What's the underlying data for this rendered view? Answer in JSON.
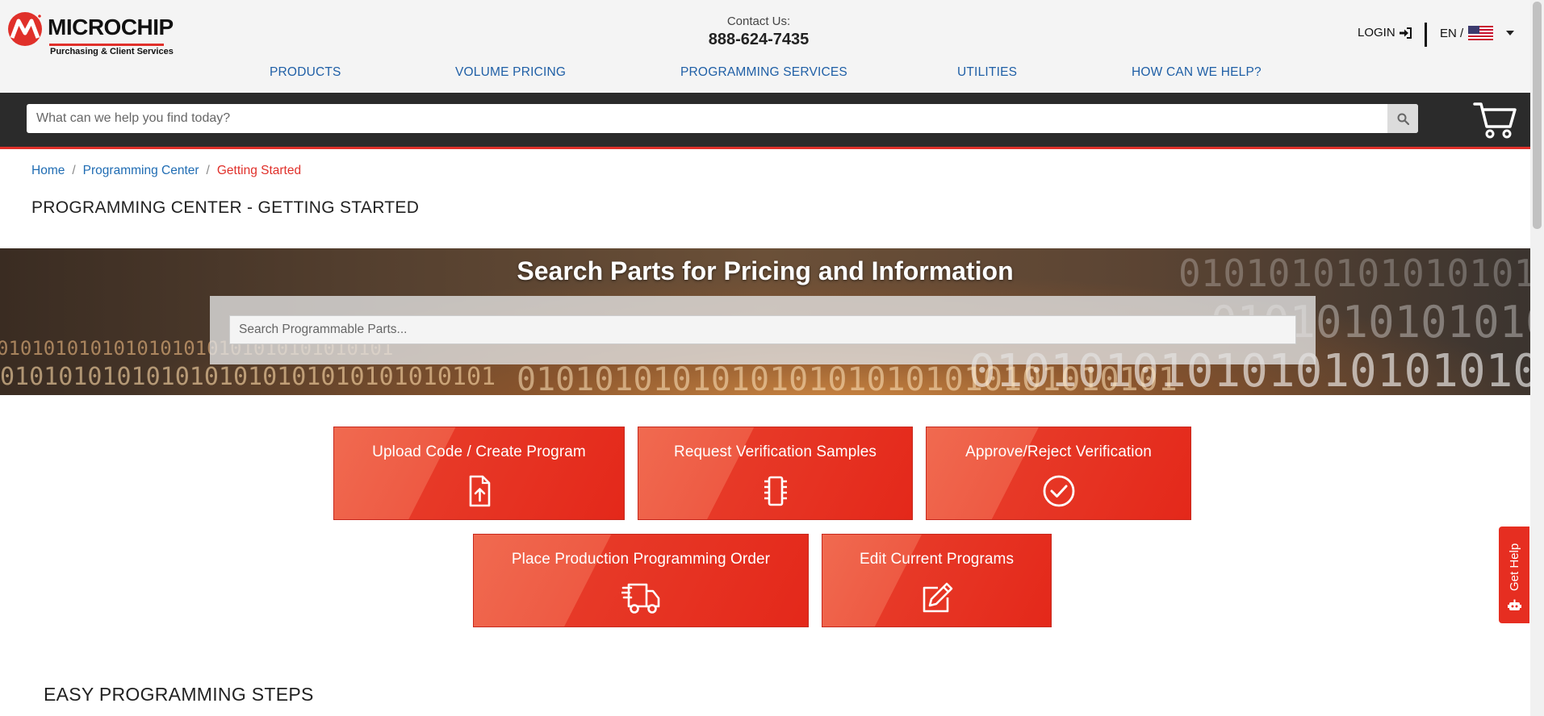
{
  "header": {
    "logo_word": "MICROCHIP",
    "logo_sub": "Purchasing & Client Services",
    "contact_label": "Contact Us:",
    "contact_phone": "888-624-7435",
    "login_label": "LOGIN",
    "lang_label": "EN /",
    "brand_color": "#e0302a"
  },
  "nav": {
    "items": [
      "PRODUCTS",
      "VOLUME PRICING",
      "PROGRAMMING SERVICES",
      "UTILITIES",
      "HOW CAN WE HELP?"
    ]
  },
  "search": {
    "placeholder": "What can we help you find today?"
  },
  "breadcrumb": {
    "items": [
      "Home",
      "Programming Center",
      "Getting Started"
    ]
  },
  "page": {
    "title": "PROGRAMMING CENTER - GETTING STARTED"
  },
  "hero": {
    "title": "Search Parts for Pricing and Information",
    "search_placeholder": "Search Programmable Parts...",
    "binary_text": "0101010101010101010101010101010101"
  },
  "tiles": [
    {
      "label": "Upload Code / Create Program",
      "icon": "file-upload-icon"
    },
    {
      "label": "Request Verification Samples",
      "icon": "chip-icon"
    },
    {
      "label": "Approve/Reject Verification",
      "icon": "check-circle-icon"
    },
    {
      "label": "Place Production Programming Order",
      "icon": "delivery-truck-icon"
    },
    {
      "label": "Edit Current Programs",
      "icon": "edit-icon"
    }
  ],
  "section": {
    "title": "EASY PROGRAMMING STEPS"
  },
  "help": {
    "label": "Get Help"
  }
}
